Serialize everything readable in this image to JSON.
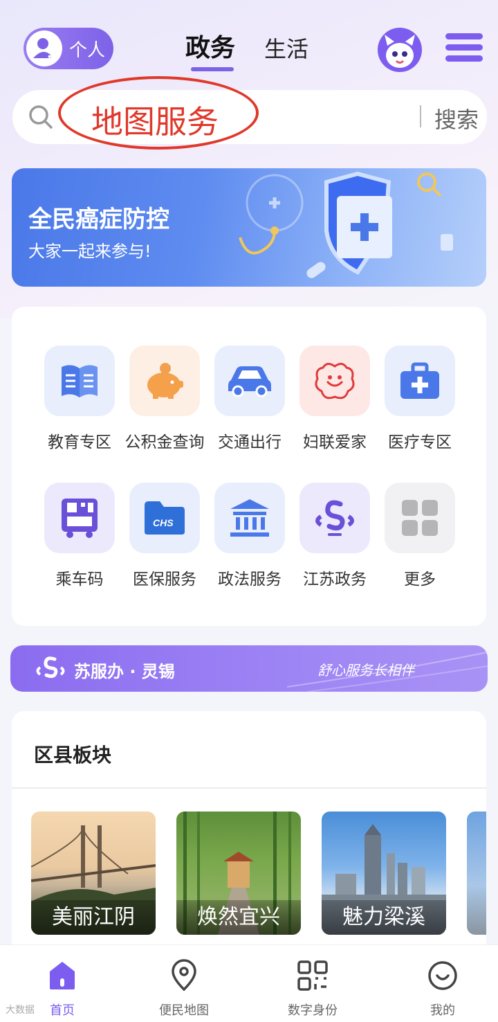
{
  "header": {
    "personal_label": "个人",
    "tabs": [
      {
        "label": "政务",
        "active": true
      },
      {
        "label": "生活",
        "active": false
      }
    ]
  },
  "search": {
    "query": "地图服务",
    "button_label": "搜索",
    "annotation_color": "#e0382a"
  },
  "banner": {
    "title": "全民癌症防控",
    "subtitle": "大家一起来参与!"
  },
  "services": [
    {
      "label": "教育专区",
      "icon": "book-icon"
    },
    {
      "label": "公积金查询",
      "icon": "piggy-bank-icon"
    },
    {
      "label": "交通出行",
      "icon": "car-icon"
    },
    {
      "label": "妇联爱家",
      "icon": "women-federation-logo-icon"
    },
    {
      "label": "医疗专区",
      "icon": "medical-kit-icon"
    },
    {
      "label": "乘车码",
      "icon": "bus-code-icon"
    },
    {
      "label": "医保服务",
      "icon": "chs-folder-icon"
    },
    {
      "label": "政法服务",
      "icon": "court-building-icon"
    },
    {
      "label": "江苏政务",
      "icon": "jiangsu-gov-icon"
    },
    {
      "label": "更多",
      "icon": "more-grid-icon"
    }
  ],
  "promo": {
    "title": "苏服办 · 灵锡",
    "slogan": "舒心服务长相伴"
  },
  "districts": {
    "title": "区县板块",
    "items": [
      {
        "label": "美丽江阴"
      },
      {
        "label": "焕然宜兴"
      },
      {
        "label": "魅力梁溪"
      }
    ]
  },
  "bottom_nav": [
    {
      "label": "首页",
      "icon": "home-icon",
      "active": true
    },
    {
      "label": "便民地图",
      "icon": "map-pin-icon",
      "active": false
    },
    {
      "label": "数字身份",
      "icon": "qr-code-icon",
      "active": false
    },
    {
      "label": "我的",
      "icon": "profile-smile-icon",
      "active": false
    }
  ],
  "watermark": "大数据"
}
